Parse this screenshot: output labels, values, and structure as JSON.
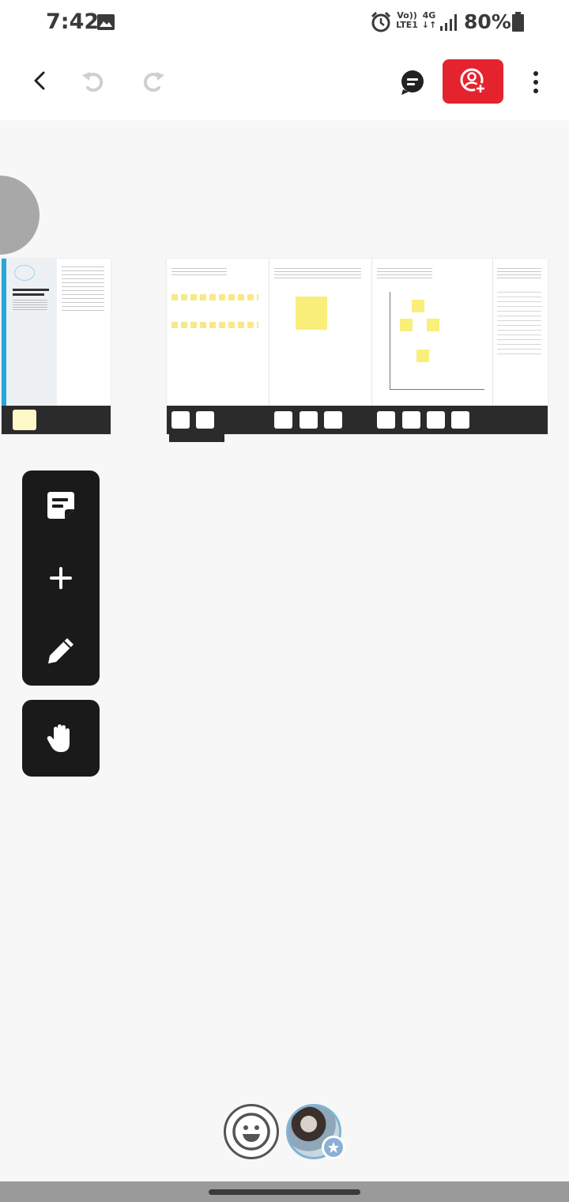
{
  "status_bar": {
    "time": "7:42",
    "volte_line1": "Vo))",
    "volte_line2": "LTE1",
    "network": "4G",
    "battery": "80%"
  },
  "toolbar": {
    "back_icon": "chevron-left-icon",
    "undo_icon": "undo-icon",
    "redo_icon": "redo-icon",
    "comments_icon": "comments-icon",
    "share_icon": "add-user-icon",
    "more_icon": "more-vertical-icon",
    "accent_color": "#e5232f"
  },
  "canvas": {
    "boards": [
      {
        "id": "brainstorm-board"
      },
      {
        "id": "activities-board"
      }
    ]
  },
  "tool_palette": {
    "tools": [
      {
        "icon": "sticky-note-icon"
      },
      {
        "icon": "plus-icon"
      },
      {
        "icon": "pen-icon"
      }
    ],
    "hand_tool_icon": "hand-icon"
  },
  "bottom": {
    "reaction_icon": "smiley-icon",
    "avatar_badge_icon": "star-icon"
  }
}
